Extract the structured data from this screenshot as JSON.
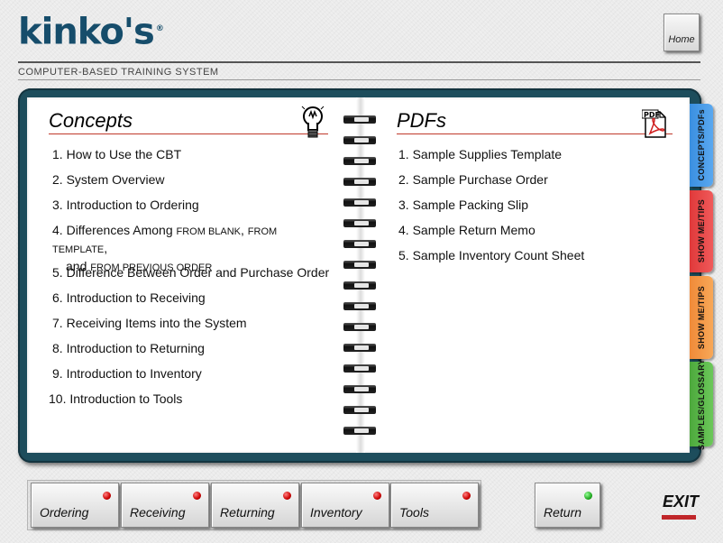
{
  "header": {
    "logo_text": "kinko's",
    "logo_reg": "®",
    "home_label": "Home",
    "subtitle": "COMPUTER-BASED TRAINING SYSTEM"
  },
  "concepts": {
    "title": "Concepts",
    "items": [
      {
        "num": "1.",
        "text": "How to Use the CBT"
      },
      {
        "num": "2.",
        "text": "System Overview"
      },
      {
        "num": "3.",
        "text": "Introduction to Ordering"
      },
      {
        "num": "4.",
        "text_a": "Differences Among ",
        "sc_a": "FROM BLANK",
        "text_b": ", ",
        "sc_b": "FROM TEMPLATE",
        "text_c": ",",
        "text_d": "and ",
        "sc_c": "FROM PREVIOUS ORDER"
      },
      {
        "num": "5.",
        "text": "Difference Between Order and Purchase Order"
      },
      {
        "num": "6.",
        "text": "Introduction to Receiving"
      },
      {
        "num": "7.",
        "text": "Receiving Items into the System"
      },
      {
        "num": "8.",
        "text": "Introduction to Returning"
      },
      {
        "num": "9.",
        "text": "Introduction to Inventory"
      },
      {
        "num": "10.",
        "text": "Introduction to Tools"
      }
    ]
  },
  "pdfs": {
    "title": "PDFs",
    "icon_text": "PDF",
    "items": [
      {
        "num": "1.",
        "text": "Sample Supplies Template"
      },
      {
        "num": "2.",
        "text": "Sample Purchase Order"
      },
      {
        "num": "3.",
        "text": "Sample Packing Slip"
      },
      {
        "num": "4.",
        "text": "Sample Return Memo"
      },
      {
        "num": "5.",
        "text": "Sample Inventory Count Sheet"
      }
    ]
  },
  "tabs": [
    {
      "label": "CONCEPTS/PDFs",
      "color": "#3a8fe0"
    },
    {
      "label": "SHOW ME/TIPS",
      "color": "#e0393a"
    },
    {
      "label": "SHOW ME/TIPS",
      "color": "#f08a38"
    },
    {
      "label": "SAMPLES/GLOSSARY",
      "color": "#4ca83c"
    }
  ],
  "nav": {
    "buttons": [
      "Ordering",
      "Receiving",
      "Returning",
      "Inventory",
      "Tools"
    ],
    "return_label": "Return",
    "exit_label": "EXIT"
  },
  "colors": {
    "binder": "#1d4d5c",
    "accent_rule": "#c0392b",
    "logo": "#164d6b"
  }
}
